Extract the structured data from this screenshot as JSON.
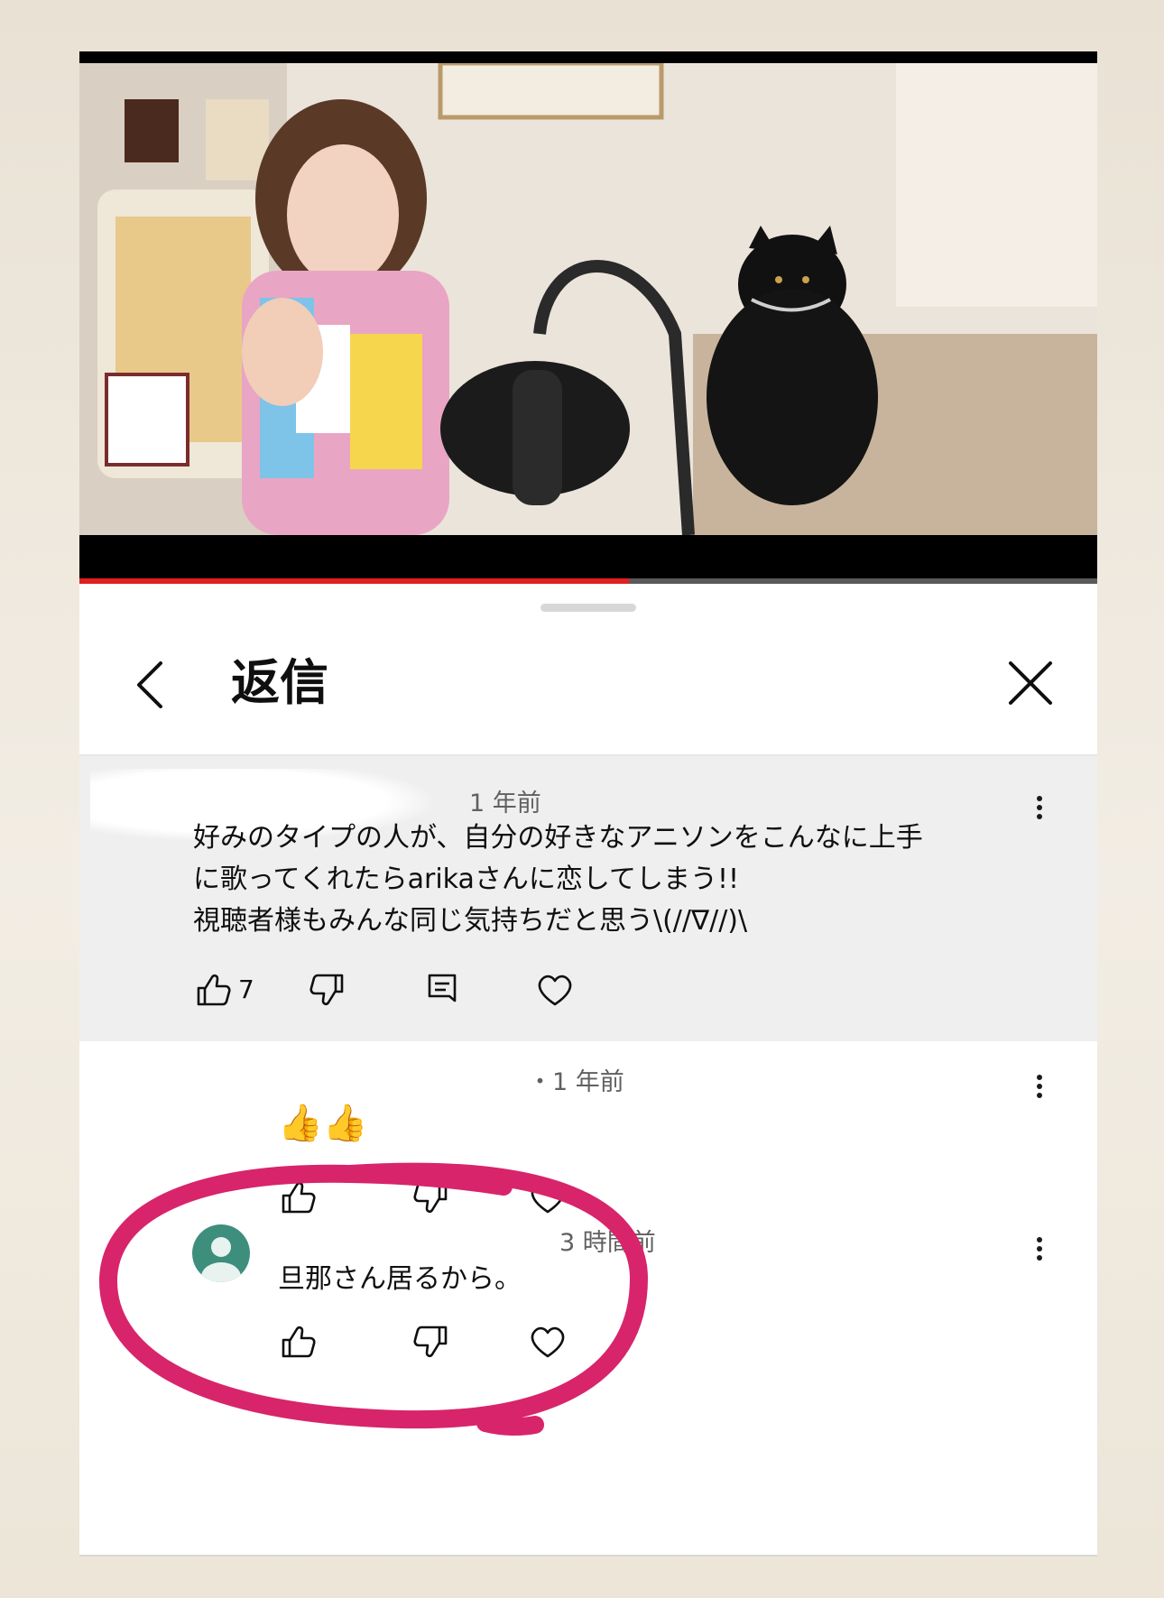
{
  "header": {
    "title": "返信"
  },
  "video": {
    "progress": 0.54
  },
  "comments": [
    {
      "author": "",
      "time": "1 年前",
      "text": "好みのタイプの人が、自分の好きなアニソンをこんなに上手\nに歌ってくれたらarikaさんに恋してしまう!!\n視聴者様もみんな同じ気持ちだと思う\\(//∇//)\\",
      "likes": "7"
    },
    {
      "author": "",
      "time": "・1 年前",
      "text": "👍👍"
    },
    {
      "author": "",
      "time": "3 時間前",
      "text": "旦那さん居るから。",
      "highlight_color": "#d8246b"
    }
  ],
  "colors": {
    "accent": "#e02020",
    "highlight": "#d8246b",
    "avatar": "#3e8e7e"
  },
  "icons": {
    "back": "chevron-left-icon",
    "close": "close-icon",
    "more": "more-vert-icon",
    "like": "thumb-up-icon",
    "dislike": "thumb-down-icon",
    "reply": "reply-icon",
    "heart": "heart-icon"
  }
}
